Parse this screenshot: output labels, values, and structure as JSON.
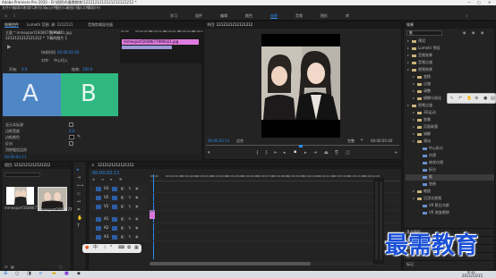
{
  "title_bar": {
    "title": "Adobe Premiere Pro 2020 - D:\\视频\\4\\最需教育\\1212121212121212121212 *"
  },
  "menu": [
    "文件(F)",
    "编辑(E)",
    "剪辑(C)",
    "序列(S)",
    "标记(M)",
    "图形(G)",
    "视图(V)",
    "窗口(W)",
    "帮助(H)"
  ],
  "workspaces": [
    "学习",
    "组件",
    "编辑",
    "颜色",
    "效果",
    "音频",
    "图形",
    "库"
  ],
  "active_workspace": "效果",
  "effect_controls": {
    "tabs": [
      "效果控件",
      "Lumetri 范围",
      "源: 1212121",
      "音频剪辑混合器"
    ],
    "clip_header": "主要 * mmexport1608677996021.jpg",
    "sequence_header": "1212121212121212 * 下载的图片 1",
    "effect_name": "推 Push",
    "duration_label": "持续时间",
    "duration_value": "00:00:01:00",
    "alignment_label": "对齐:",
    "alignment_value": "中心切入",
    "start_label": "开始:",
    "start_value": "0.0",
    "end_label": "结束:",
    "end_value": "100.0",
    "preview_a": "A",
    "preview_b": "B",
    "show_actual_label": "显示实际源",
    "border_width_label": "边框宽度",
    "border_width_value": "0.0",
    "border_color_label": "边框颜色",
    "reverse_label": "反向",
    "antialias_label": "消除锯齿品质",
    "antialias_value": "关",
    "timecode": "00:00:02:11",
    "mini_clip": "mmexport1608677996021.jpg",
    "mini_ruler": [
      "00:00",
      "00:00:00:15",
      "00:00:01:00",
      "00:00:01:15",
      "00:00:02:00",
      "00:00:02:15"
    ]
  },
  "program_monitor": {
    "tab": "节目: 1212121212121212",
    "timecode_left": "00:00:02:11",
    "fit_label": "适合",
    "quality_label": "完整",
    "timecode_right": "00:00:05:00",
    "tooltip": "播放-停止切换 (Space)"
  },
  "project": {
    "tab": "项目: 1212121212121212",
    "items": [
      {
        "name": "mmexport1608677996021",
        "duration": "5:00"
      },
      {
        "name": "mmexport1608677996...",
        "duration": "5:00"
      }
    ]
  },
  "timeline": {
    "tab": "1212121212121212",
    "timecode": "00:00:02:11",
    "ruler": [
      "00:00",
      "00:00:01:00",
      "00:00:02:00",
      "00:00:03:00",
      "00:00:04:00",
      "00:00:05:00",
      "00:00:06:00",
      "00:00:07:00",
      "00:00:08:00",
      "00:00:09:00",
      "00:00:10:00",
      "00:00:11:00",
      "00:00:12:00",
      "00:00:13:00",
      "00:00:14:00"
    ],
    "video_tracks": [
      "V3",
      "V2",
      "V1"
    ],
    "audio_tracks": [
      "A1",
      "A2",
      "A3"
    ],
    "master_label": "主声道",
    "master_value": "0.0"
  },
  "effects_panel": {
    "tab": "效果",
    "search_value": "推",
    "sections": [
      {
        "label": "预设",
        "depth": 0
      },
      {
        "label": "Lumetri 预设",
        "depth": 0
      },
      {
        "label": "音频效果",
        "depth": 0
      },
      {
        "label": "音频过渡",
        "depth": 0
      },
      {
        "label": "视频效果",
        "depth": 0
      },
      {
        "label": "变换",
        "depth": 1
      },
      {
        "label": "过渡",
        "depth": 1
      },
      {
        "label": "调整",
        "depth": 1
      },
      {
        "label": "模糊与锐化",
        "depth": 1
      },
      {
        "label": "视频过渡",
        "depth": 0
      },
      {
        "label": "3D运动",
        "depth": 1
      },
      {
        "label": "划像",
        "depth": 1
      },
      {
        "label": "页面剥落",
        "depth": 1
      },
      {
        "label": "溶解",
        "depth": 1
      },
      {
        "label": "滑动",
        "depth": 1
      },
      {
        "label": "中心拆分",
        "depth": 2
      },
      {
        "label": "内滑",
        "depth": 2
      },
      {
        "label": "带状内滑",
        "depth": 2
      },
      {
        "label": "拆分",
        "depth": 2
      },
      {
        "label": "推",
        "depth": 2
      },
      {
        "label": "急摇",
        "depth": 2
      },
      {
        "label": "缩放",
        "depth": 1
      },
      {
        "label": "沉浸式视频",
        "depth": 1
      },
      {
        "label": "VR 默比乌斯",
        "depth": 2
      },
      {
        "label": "VR 渐变擦除",
        "depth": 2
      }
    ],
    "bottom_sections": [
      "基本图形",
      "基本声音",
      "Lumetri 颜色",
      "库",
      "标记"
    ]
  },
  "watermark": "最需教育",
  "taskbar": {
    "time": "9:31",
    "date": "2021/10/15"
  }
}
